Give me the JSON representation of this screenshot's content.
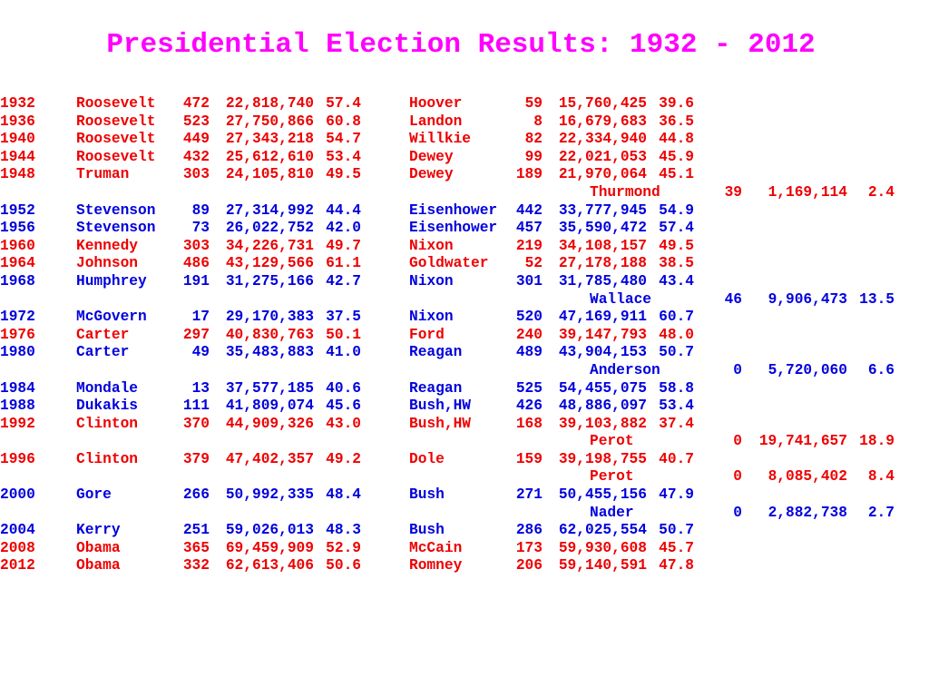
{
  "title": "Presidential Election Results: 1932 - 2012",
  "colors": {
    "title": "#ff00ff",
    "democrat_winner_red": "#ee0000",
    "republican_blue": "#0000dd"
  },
  "rows": [
    {
      "type": "main",
      "year": "1932",
      "color": "r",
      "d_name": "Roosevelt",
      "d_ev": "472",
      "d_pop": "22,818,740",
      "d_pct": "57.4",
      "r_color": "r",
      "r_name": "Hoover",
      "r_ev": "59",
      "r_pop": "15,760,425",
      "r_pct": "39.6"
    },
    {
      "type": "main",
      "year": "1936",
      "color": "r",
      "d_name": "Roosevelt",
      "d_ev": "523",
      "d_pop": "27,750,866",
      "d_pct": "60.8",
      "r_color": "r",
      "r_name": "Landon",
      "r_ev": "8",
      "r_pop": "16,679,683",
      "r_pct": "36.5"
    },
    {
      "type": "main",
      "year": "1940",
      "color": "r",
      "d_name": "Roosevelt",
      "d_ev": "449",
      "d_pop": "27,343,218",
      "d_pct": "54.7",
      "r_color": "r",
      "r_name": "Willkie",
      "r_ev": "82",
      "r_pop": "22,334,940",
      "r_pct": "44.8"
    },
    {
      "type": "main",
      "year": "1944",
      "color": "r",
      "d_name": "Roosevelt",
      "d_ev": "432",
      "d_pop": "25,612,610",
      "d_pct": "53.4",
      "r_color": "r",
      "r_name": "Dewey",
      "r_ev": "99",
      "r_pop": "22,021,053",
      "r_pct": "45.9"
    },
    {
      "type": "main",
      "year": "1948",
      "color": "r",
      "d_name": "Truman",
      "d_ev": "303",
      "d_pop": "24,105,810",
      "d_pct": "49.5",
      "r_color": "r",
      "r_name": "Dewey",
      "r_ev": "189",
      "r_pop": "21,970,064",
      "r_pct": "45.1"
    },
    {
      "type": "third",
      "color": "r",
      "t_name": "Thurmond",
      "t_ev": "39",
      "t_pop": "1,169,114",
      "t_pct": "2.4"
    },
    {
      "type": "main",
      "year": "1952",
      "color": "b",
      "d_name": "Stevenson",
      "d_ev": "89",
      "d_pop": "27,314,992",
      "d_pct": "44.4",
      "r_color": "b",
      "r_name": "Eisenhower",
      "r_ev": "442",
      "r_pop": "33,777,945",
      "r_pct": "54.9"
    },
    {
      "type": "main",
      "year": "1956",
      "color": "b",
      "d_name": "Stevenson",
      "d_ev": "73",
      "d_pop": "26,022,752",
      "d_pct": "42.0",
      "r_color": "b",
      "r_name": "Eisenhower",
      "r_ev": "457",
      "r_pop": "35,590,472",
      "r_pct": "57.4"
    },
    {
      "type": "main",
      "year": "1960",
      "color": "r",
      "d_name": "Kennedy",
      "d_ev": "303",
      "d_pop": "34,226,731",
      "d_pct": "49.7",
      "r_color": "r",
      "r_name": "Nixon",
      "r_ev": "219",
      "r_pop": "34,108,157",
      "r_pct": "49.5"
    },
    {
      "type": "main",
      "year": "1964",
      "color": "r",
      "d_name": "Johnson",
      "d_ev": "486",
      "d_pop": "43,129,566",
      "d_pct": "61.1",
      "r_color": "r",
      "r_name": "Goldwater",
      "r_ev": "52",
      "r_pop": "27,178,188",
      "r_pct": "38.5"
    },
    {
      "type": "main",
      "year": "1968",
      "color": "b",
      "d_name": "Humphrey",
      "d_ev": "191",
      "d_pop": "31,275,166",
      "d_pct": "42.7",
      "r_color": "b",
      "r_name": "Nixon",
      "r_ev": "301",
      "r_pop": "31,785,480",
      "r_pct": "43.4"
    },
    {
      "type": "third",
      "color": "b",
      "t_name": "Wallace",
      "t_ev": "46",
      "t_pop": "9,906,473",
      "t_pct": "13.5"
    },
    {
      "type": "main",
      "year": "1972",
      "color": "b",
      "d_name": "McGovern",
      "d_ev": "17",
      "d_pop": "29,170,383",
      "d_pct": "37.5",
      "r_color": "b",
      "r_name": "Nixon",
      "r_ev": "520",
      "r_pop": "47,169,911",
      "r_pct": "60.7"
    },
    {
      "type": "main",
      "year": "1976",
      "color": "r",
      "d_name": "Carter",
      "d_ev": "297",
      "d_pop": "40,830,763",
      "d_pct": "50.1",
      "r_color": "r",
      "r_name": "Ford",
      "r_ev": "240",
      "r_pop": "39,147,793",
      "r_pct": "48.0"
    },
    {
      "type": "main",
      "year": "1980",
      "color": "b",
      "d_name": "Carter",
      "d_ev": "49",
      "d_pop": "35,483,883",
      "d_pct": "41.0",
      "r_color": "b",
      "r_name": "Reagan",
      "r_ev": "489",
      "r_pop": "43,904,153",
      "r_pct": "50.7"
    },
    {
      "type": "third",
      "color": "b",
      "t_name": "Anderson",
      "t_ev": "0",
      "t_pop": "5,720,060",
      "t_pct": "6.6"
    },
    {
      "type": "main",
      "year": "1984",
      "color": "b",
      "d_name": "Mondale",
      "d_ev": "13",
      "d_pop": "37,577,185",
      "d_pct": "40.6",
      "r_color": "b",
      "r_name": "Reagan",
      "r_ev": "525",
      "r_pop": "54,455,075",
      "r_pct": "58.8"
    },
    {
      "type": "main",
      "year": "1988",
      "color": "b",
      "d_name": "Dukakis",
      "d_ev": "111",
      "d_pop": "41,809,074",
      "d_pct": "45.6",
      "r_color": "b",
      "r_name": "Bush,HW",
      "r_ev": "426",
      "r_pop": "48,886,097",
      "r_pct": "53.4"
    },
    {
      "type": "main",
      "year": "1992",
      "color": "r",
      "d_name": "Clinton",
      "d_ev": "370",
      "d_pop": "44,909,326",
      "d_pct": "43.0",
      "r_color": "r",
      "r_name": "Bush,HW",
      "r_ev": "168",
      "r_pop": "39,103,882",
      "r_pct": "37.4"
    },
    {
      "type": "third",
      "color": "r",
      "t_name": "Perot",
      "t_ev": "0",
      "t_pop": "19,741,657",
      "t_pct": "18.9"
    },
    {
      "type": "main",
      "year": "1996",
      "color": "r",
      "d_name": "Clinton",
      "d_ev": "379",
      "d_pop": "47,402,357",
      "d_pct": "49.2",
      "r_color": "r",
      "r_name": "Dole",
      "r_ev": "159",
      "r_pop": "39,198,755",
      "r_pct": "40.7"
    },
    {
      "type": "third",
      "color": "r",
      "t_name": "Perot",
      "t_ev": "0",
      "t_pop": "8,085,402",
      "t_pct": "8.4"
    },
    {
      "type": "main",
      "year": "2000",
      "color": "b",
      "d_name": "Gore",
      "d_ev": "266",
      "d_pop": "50,992,335",
      "d_pct": "48.4",
      "r_color": "b",
      "r_name": "Bush",
      "r_ev": "271",
      "r_pop": "50,455,156",
      "r_pct": "47.9"
    },
    {
      "type": "third",
      "color": "b",
      "t_name": "Nader",
      "t_ev": "0",
      "t_pop": "2,882,738",
      "t_pct": "2.7"
    },
    {
      "type": "main",
      "year": "2004",
      "color": "b",
      "d_name": "Kerry",
      "d_ev": "251",
      "d_pop": "59,026,013",
      "d_pct": "48.3",
      "r_color": "b",
      "r_name": "Bush",
      "r_ev": "286",
      "r_pop": "62,025,554",
      "r_pct": "50.7"
    },
    {
      "type": "main",
      "year": "2008",
      "color": "r",
      "d_name": "Obama",
      "d_ev": "365",
      "d_pop": "69,459,909",
      "d_pct": "52.9",
      "r_color": "r",
      "r_name": "McCain",
      "r_ev": "173",
      "r_pop": "59,930,608",
      "r_pct": "45.7"
    },
    {
      "type": "main",
      "year": "2012",
      "color": "r",
      "d_name": "Obama",
      "d_ev": "332",
      "d_pop": "62,613,406",
      "d_pct": "50.6",
      "r_color": "r",
      "r_name": "Romney",
      "r_ev": "206",
      "r_pop": "59,140,591",
      "r_pct": "47.8"
    }
  ]
}
